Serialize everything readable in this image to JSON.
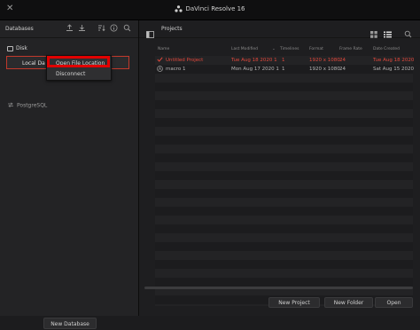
{
  "app": {
    "title": "DaVinci Resolve 16",
    "close_glyph": "✕"
  },
  "left_panel": {
    "title": "Databases",
    "disk_section": "Disk",
    "database_row_label": "Local Da",
    "postgres_section": "PostgreSQL",
    "new_database_button": "New Database",
    "header_icons": [
      "upload-icon",
      "download-icon",
      "sort-icon",
      "info-icon",
      "search-icon"
    ]
  },
  "context_menu": {
    "items": [
      "Open File Location",
      "Disconnect"
    ],
    "highlight_color": "#e00000"
  },
  "right_panel": {
    "title": "Projects",
    "columns": [
      "Name",
      "Last Modified",
      "Timelines",
      "Format",
      "Frame Rate",
      "Date Created"
    ],
    "rows": [
      {
        "name": "Untitled Project",
        "modified": "Tue Aug 18 2020 1",
        "timelines": "1",
        "format": "1920 x 1080",
        "fps": "24",
        "created": "Tue Aug 18 2020"
      },
      {
        "name": "macro 1",
        "modified": "Mon Aug 17 2020 1",
        "timelines": "1",
        "format": "1920 x 1080",
        "fps": "24",
        "created": "Sat Aug 15 2020"
      }
    ],
    "buttons": {
      "new_project": "New Project",
      "new_folder": "New Folder",
      "open": "Open"
    }
  },
  "colors": {
    "accent_red": "#e2483c",
    "background": "#1c1c1e"
  }
}
